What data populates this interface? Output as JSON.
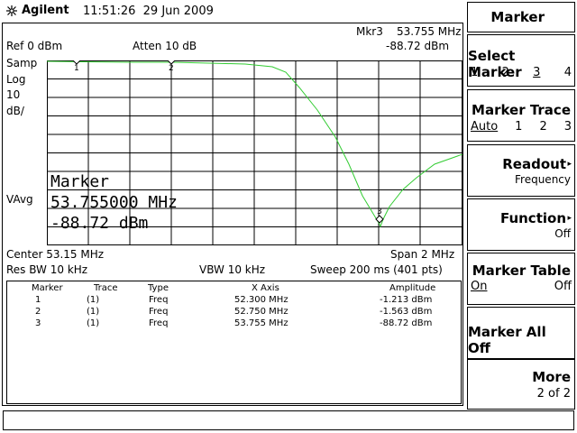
{
  "header": {
    "brand": "Agilent",
    "time": "11:51:26",
    "date": "29 Jun 2009"
  },
  "screen": {
    "marker_readout_label": "Mkr3",
    "marker_readout_freq": "53.755 MHz",
    "marker_readout_amp": "-88.72 dBm",
    "ref_level": "Ref 0 dBm",
    "atten": "Atten 10 dB",
    "left_annotations": [
      "Samp",
      "Log",
      "10",
      "dB/"
    ],
    "vavg": "VAvg",
    "marker_overlay_title": "Marker",
    "marker_overlay_freq": "53.755000 MHz",
    "marker_overlay_amp": "-88.72 dBm",
    "center": "Center 53.15 MHz",
    "span": "Span 2 MHz",
    "res_bw": "Res BW 10 kHz",
    "vbw": "VBW 10 kHz",
    "sweep": "Sweep 200 ms (401 pts)",
    "trace_color": "#33cc33",
    "markers_on_trace": [
      "1",
      "2",
      "3"
    ]
  },
  "marker_table": {
    "headers": [
      "Marker",
      "Trace",
      "Type",
      "X Axis",
      "Amplitude"
    ],
    "rows": [
      [
        "1",
        "(1)",
        "Freq",
        "52.300 MHz",
        "-1.213 dBm"
      ],
      [
        "2",
        "(1)",
        "Freq",
        "52.750 MHz",
        "-1.563 dBm"
      ],
      [
        "3",
        "(1)",
        "Freq",
        "53.755 MHz",
        "-88.72 dBm"
      ]
    ]
  },
  "softkeys": {
    "menu_title": "Marker",
    "select_marker": {
      "label": "Select Marker",
      "options": [
        "1",
        "2",
        "3",
        "4"
      ],
      "selected": "3"
    },
    "marker_trace": {
      "label": "Marker Trace",
      "options": [
        "Auto",
        "1",
        "2",
        "3"
      ],
      "selected": "Auto"
    },
    "readout": {
      "label": "Readout",
      "value": "Frequency"
    },
    "function": {
      "label": "Function",
      "value": "Off"
    },
    "marker_table": {
      "label": "Marker Table",
      "on": "On",
      "off": "Off"
    },
    "marker_all_off": {
      "label": "Marker All Off"
    },
    "more": {
      "label": "More",
      "value": "2 of 2"
    }
  }
}
